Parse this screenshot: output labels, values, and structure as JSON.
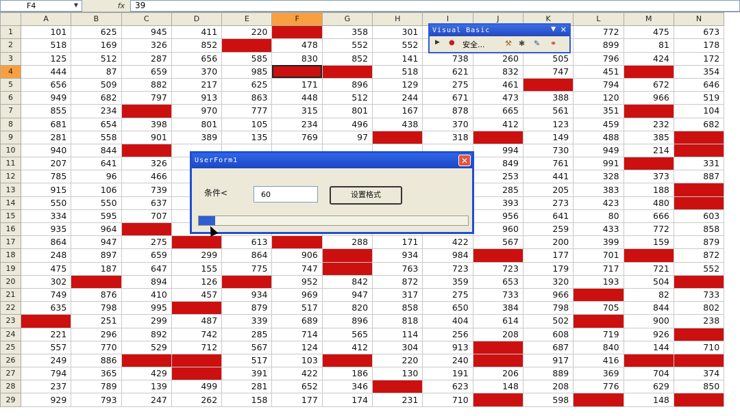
{
  "formula_bar": {
    "name_box": "F4",
    "fx": "fx",
    "value": "39"
  },
  "columns": [
    "A",
    "B",
    "C",
    "D",
    "E",
    "F",
    "G",
    "H",
    "I",
    "J",
    "K",
    "L",
    "M",
    "N"
  ],
  "selected_column": "F",
  "selected_row": 4,
  "active_cell": "F4",
  "colors": {
    "highlight": "#cc1010",
    "title_bar": "#2f66e8",
    "selected_header": "#f8a040"
  },
  "rows": [
    {
      "n": 1,
      "cells": [
        "101",
        "625",
        "945",
        "411",
        "220",
        "",
        "358",
        "301",
        "",
        "",
        "",
        "772",
        "475",
        "673"
      ],
      "red": [
        5
      ]
    },
    {
      "n": 2,
      "cells": [
        "518",
        "169",
        "326",
        "852",
        "",
        "478",
        "552",
        "552",
        "",
        "",
        "",
        "899",
        "81",
        "178"
      ],
      "red": [
        4
      ]
    },
    {
      "n": 3,
      "cells": [
        "125",
        "512",
        "287",
        "656",
        "585",
        "830",
        "852",
        "141",
        "738",
        "260",
        "505",
        "796",
        "424",
        "172"
      ],
      "red": []
    },
    {
      "n": 4,
      "cells": [
        "444",
        "87",
        "659",
        "370",
        "985",
        "",
        "",
        "518",
        "621",
        "832",
        "747",
        "451",
        "",
        "354"
      ],
      "red": [
        5,
        6,
        12
      ]
    },
    {
      "n": 5,
      "cells": [
        "656",
        "509",
        "882",
        "217",
        "625",
        "171",
        "896",
        "129",
        "275",
        "461",
        "",
        "794",
        "672",
        "646"
      ],
      "red": [
        10
      ]
    },
    {
      "n": 6,
      "cells": [
        "949",
        "682",
        "797",
        "913",
        "863",
        "448",
        "512",
        "244",
        "671",
        "473",
        "388",
        "120",
        "966",
        "519"
      ],
      "red": []
    },
    {
      "n": 7,
      "cells": [
        "855",
        "234",
        "",
        "970",
        "777",
        "315",
        "801",
        "167",
        "878",
        "665",
        "561",
        "351",
        "",
        "104"
      ],
      "red": [
        2,
        12
      ]
    },
    {
      "n": 8,
      "cells": [
        "681",
        "654",
        "398",
        "801",
        "105",
        "234",
        "496",
        "438",
        "370",
        "412",
        "123",
        "459",
        "232",
        "682"
      ],
      "red": []
    },
    {
      "n": 9,
      "cells": [
        "281",
        "558",
        "901",
        "389",
        "135",
        "769",
        "97",
        "",
        "318",
        "",
        "149",
        "488",
        "385",
        ""
      ],
      "red": [
        7,
        9,
        13
      ]
    },
    {
      "n": 10,
      "cells": [
        "940",
        "844",
        "",
        "",
        "",
        "",
        "",
        "",
        "",
        "994",
        "730",
        "949",
        "214",
        ""
      ],
      "red": [
        2,
        13
      ]
    },
    {
      "n": 11,
      "cells": [
        "207",
        "641",
        "326",
        "",
        "",
        "",
        "",
        "",
        "",
        "849",
        "761",
        "991",
        "",
        "331"
      ],
      "red": [
        12
      ]
    },
    {
      "n": 12,
      "cells": [
        "785",
        "96",
        "466",
        "",
        "",
        "",
        "",
        "",
        "",
        "253",
        "441",
        "328",
        "373",
        "887"
      ],
      "red": []
    },
    {
      "n": 13,
      "cells": [
        "915",
        "106",
        "739",
        "",
        "",
        "",
        "",
        "",
        "",
        "285",
        "205",
        "383",
        "188",
        ""
      ],
      "red": [
        13
      ]
    },
    {
      "n": 14,
      "cells": [
        "550",
        "550",
        "637",
        "",
        "",
        "",
        "",
        "",
        "",
        "393",
        "273",
        "423",
        "480",
        ""
      ],
      "red": [
        13
      ]
    },
    {
      "n": 15,
      "cells": [
        "334",
        "595",
        "707",
        "",
        "",
        "",
        "",
        "",
        "",
        "956",
        "641",
        "80",
        "666",
        "603"
      ],
      "red": []
    },
    {
      "n": 16,
      "cells": [
        "935",
        "964",
        "",
        "",
        "",
        "",
        "",
        "",
        "",
        "960",
        "259",
        "433",
        "772",
        "858"
      ],
      "red": [
        2
      ]
    },
    {
      "n": 17,
      "cells": [
        "864",
        "947",
        "275",
        "",
        "613",
        "",
        "288",
        "171",
        "422",
        "567",
        "200",
        "399",
        "159",
        "879"
      ],
      "red": [
        3,
        5
      ]
    },
    {
      "n": 18,
      "cells": [
        "248",
        "897",
        "659",
        "299",
        "864",
        "906",
        "270",
        "934",
        "984",
        "",
        "177",
        "701",
        "",
        "872"
      ],
      "red": [
        6,
        9,
        12
      ]
    },
    {
      "n": 19,
      "cells": [
        "475",
        "187",
        "647",
        "155",
        "775",
        "747",
        "",
        "763",
        "723",
        "723",
        "179",
        "717",
        "721",
        "552"
      ],
      "red": [
        6
      ]
    },
    {
      "n": 20,
      "cells": [
        "302",
        "",
        "894",
        "126",
        "",
        "952",
        "842",
        "872",
        "359",
        "653",
        "320",
        "193",
        "504",
        ""
      ],
      "red": [
        1,
        4,
        13
      ]
    },
    {
      "n": 21,
      "cells": [
        "749",
        "876",
        "410",
        "457",
        "934",
        "969",
        "947",
        "317",
        "275",
        "733",
        "966",
        "",
        "82",
        "733"
      ],
      "red": [
        11
      ]
    },
    {
      "n": 22,
      "cells": [
        "635",
        "798",
        "995",
        "",
        "879",
        "517",
        "820",
        "858",
        "650",
        "384",
        "798",
        "705",
        "844",
        "802"
      ],
      "red": [
        3
      ]
    },
    {
      "n": 23,
      "cells": [
        "",
        "251",
        "299",
        "487",
        "339",
        "689",
        "896",
        "818",
        "404",
        "614",
        "502",
        "",
        "900",
        "238"
      ],
      "red": [
        0,
        11
      ]
    },
    {
      "n": 24,
      "cells": [
        "221",
        "296",
        "892",
        "742",
        "285",
        "714",
        "565",
        "114",
        "256",
        "208",
        "608",
        "719",
        "926",
        ""
      ],
      "red": [
        13
      ]
    },
    {
      "n": 25,
      "cells": [
        "557",
        "770",
        "529",
        "712",
        "567",
        "124",
        "412",
        "304",
        "913",
        "",
        "687",
        "840",
        "144",
        "710"
      ],
      "red": [
        9
      ]
    },
    {
      "n": 26,
      "cells": [
        "249",
        "886",
        "",
        "",
        "517",
        "103",
        "",
        "220",
        "240",
        "",
        "917",
        "416",
        "",
        ""
      ],
      "red": [
        2,
        3,
        6,
        9,
        12,
        13
      ]
    },
    {
      "n": 27,
      "cells": [
        "794",
        "365",
        "429",
        "",
        "391",
        "422",
        "186",
        "130",
        "191",
        "206",
        "889",
        "369",
        "704",
        "374"
      ],
      "red": [
        3
      ]
    },
    {
      "n": 28,
      "cells": [
        "237",
        "789",
        "139",
        "499",
        "281",
        "652",
        "346",
        "",
        "623",
        "148",
        "208",
        "776",
        "629",
        "850"
      ],
      "red": [
        7
      ]
    },
    {
      "n": 29,
      "cells": [
        "929",
        "793",
        "247",
        "262",
        "158",
        "177",
        "174",
        "231",
        "710",
        "",
        "598",
        "",
        "148",
        ""
      ],
      "red": [
        9,
        11,
        13
      ]
    }
  ],
  "vb_toolbar": {
    "title": "Visual Basic",
    "menu_arrow": "▼",
    "close": "✕",
    "security_label": "安全..."
  },
  "dialog": {
    "title": "UserForm1",
    "close": "✕",
    "condition_label": "条件<",
    "condition_value": "60",
    "button_label": "设置格式",
    "progress": 0.06
  }
}
